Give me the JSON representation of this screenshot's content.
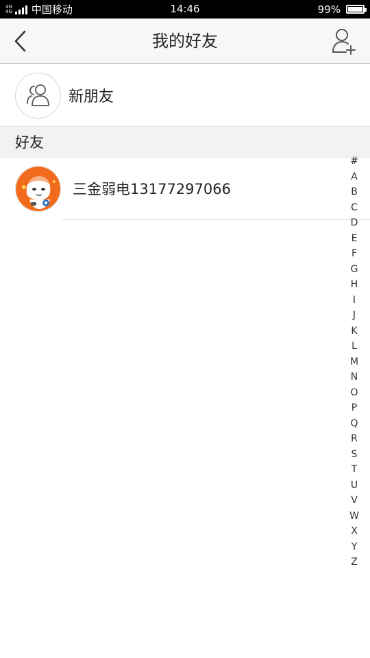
{
  "status_bar": {
    "network_top": "4G",
    "network_bottom": "4G",
    "carrier": "中国移动",
    "time": "14:46",
    "battery": "99%",
    "battery_level": 0.99
  },
  "header": {
    "title": "我的好友",
    "back_icon": "chevron-left-icon",
    "add_icon": "add-user-icon"
  },
  "new_friends": {
    "label": "新朋友",
    "icon": "group-icon"
  },
  "friends_section": {
    "title": "好友",
    "items": [
      {
        "name": "三金弱电13177297066",
        "avatar": "cartoon-avatar"
      }
    ]
  },
  "alphabet_index": [
    "#",
    "A",
    "B",
    "C",
    "D",
    "E",
    "F",
    "G",
    "H",
    "I",
    "J",
    "K",
    "L",
    "M",
    "N",
    "O",
    "P",
    "Q",
    "R",
    "S",
    "T",
    "U",
    "V",
    "W",
    "X",
    "Y",
    "Z"
  ],
  "colors": {
    "status_bar": "#000000",
    "header_bg": "#f7f7f7",
    "section_bg": "#f2f2f2",
    "avatar_orange": "#f26b1d"
  }
}
